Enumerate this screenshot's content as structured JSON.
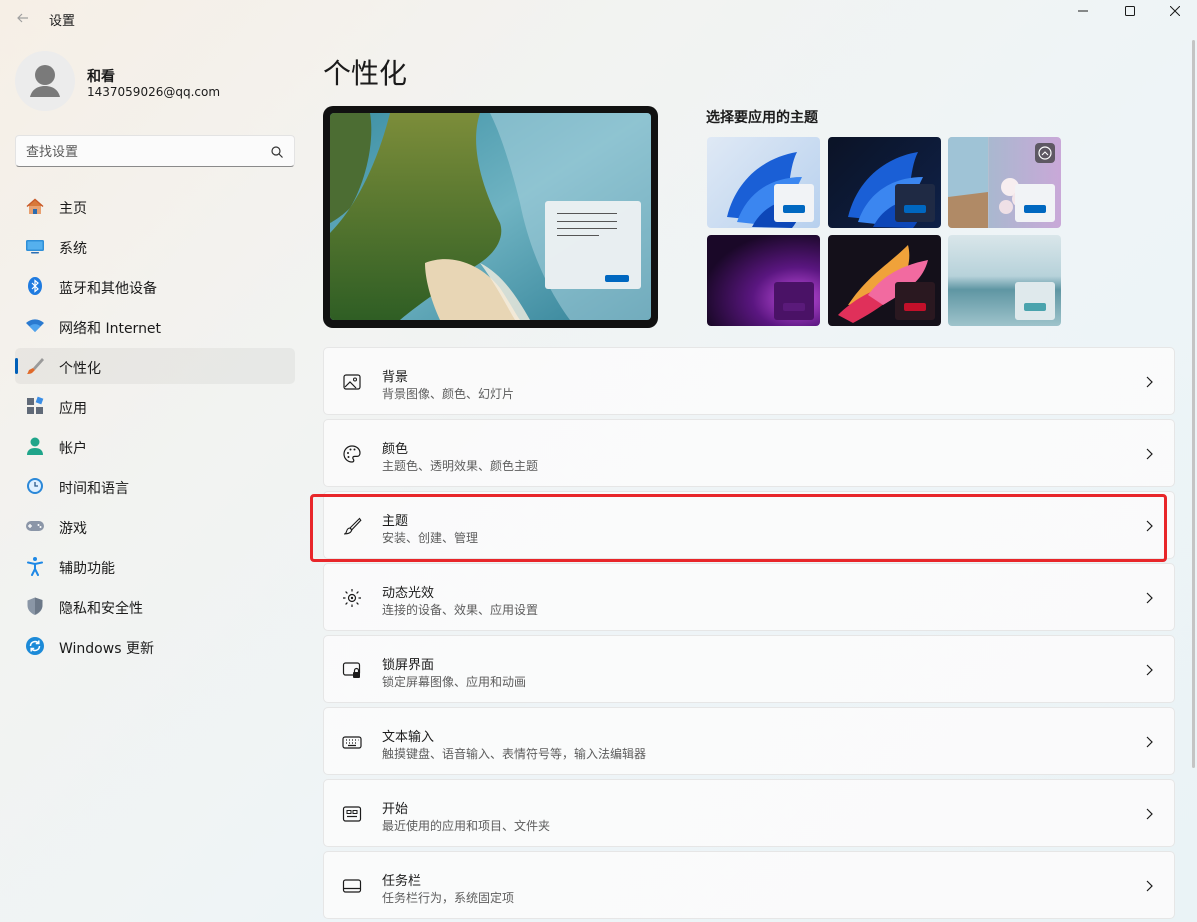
{
  "window": {
    "title": "设置",
    "back_icon": "back-arrow-icon",
    "controls": [
      "minimize-icon",
      "maximize-icon",
      "close-icon"
    ]
  },
  "profile": {
    "name": "和看",
    "email": "1437059026@qq.com"
  },
  "search": {
    "placeholder": "查找设置"
  },
  "sidebar": {
    "items": [
      {
        "label": "主页",
        "icon": "home-icon"
      },
      {
        "label": "系统",
        "icon": "system-icon"
      },
      {
        "label": "蓝牙和其他设备",
        "icon": "bluetooth-icon"
      },
      {
        "label": "网络和 Internet",
        "icon": "wifi-icon"
      },
      {
        "label": "个性化",
        "icon": "brush-icon",
        "active": true
      },
      {
        "label": "应用",
        "icon": "apps-icon"
      },
      {
        "label": "帐户",
        "icon": "account-icon"
      },
      {
        "label": "时间和语言",
        "icon": "time-language-icon"
      },
      {
        "label": "游戏",
        "icon": "gamepad-icon"
      },
      {
        "label": "辅助功能",
        "icon": "accessibility-icon"
      },
      {
        "label": "隐私和安全性",
        "icon": "shield-icon"
      },
      {
        "label": "Windows 更新",
        "icon": "update-icon"
      }
    ]
  },
  "main": {
    "title": "个性化",
    "themes_title": "选择要应用的主题",
    "themes": [
      {
        "name": "windows-light",
        "accent": "#0067c0"
      },
      {
        "name": "windows-dark",
        "accent": "#0067c0"
      },
      {
        "name": "spotlight",
        "accent": "#0067c0"
      },
      {
        "name": "glow",
        "accent": "#5a1a7a"
      },
      {
        "name": "captured-motion",
        "accent": "#c3102a"
      },
      {
        "name": "flow",
        "accent": "#4aa3ad"
      }
    ],
    "cards": [
      {
        "title": "背景",
        "subtitle": "背景图像、颜色、幻灯片",
        "icon": "picture-icon"
      },
      {
        "title": "颜色",
        "subtitle": "主题色、透明效果、颜色主题",
        "icon": "palette-icon"
      },
      {
        "title": "主题",
        "subtitle": "安装、创建、管理",
        "icon": "brush-icon",
        "highlighted": true
      },
      {
        "title": "动态光效",
        "subtitle": "连接的设备、效果、应用设置",
        "icon": "dynamic-lighting-icon"
      },
      {
        "title": "锁屏界面",
        "subtitle": "锁定屏幕图像、应用和动画",
        "icon": "lock-screen-icon"
      },
      {
        "title": "文本输入",
        "subtitle": "触摸键盘、语音输入、表情符号等，输入法编辑器",
        "icon": "keyboard-icon"
      },
      {
        "title": "开始",
        "subtitle": "最近使用的应用和项目、文件夹",
        "icon": "start-icon"
      },
      {
        "title": "任务栏",
        "subtitle": "任务栏行为，系统固定项",
        "icon": "taskbar-icon"
      }
    ]
  },
  "colors": {
    "accent": "#005fb8",
    "highlight_border": "#e8262a"
  }
}
